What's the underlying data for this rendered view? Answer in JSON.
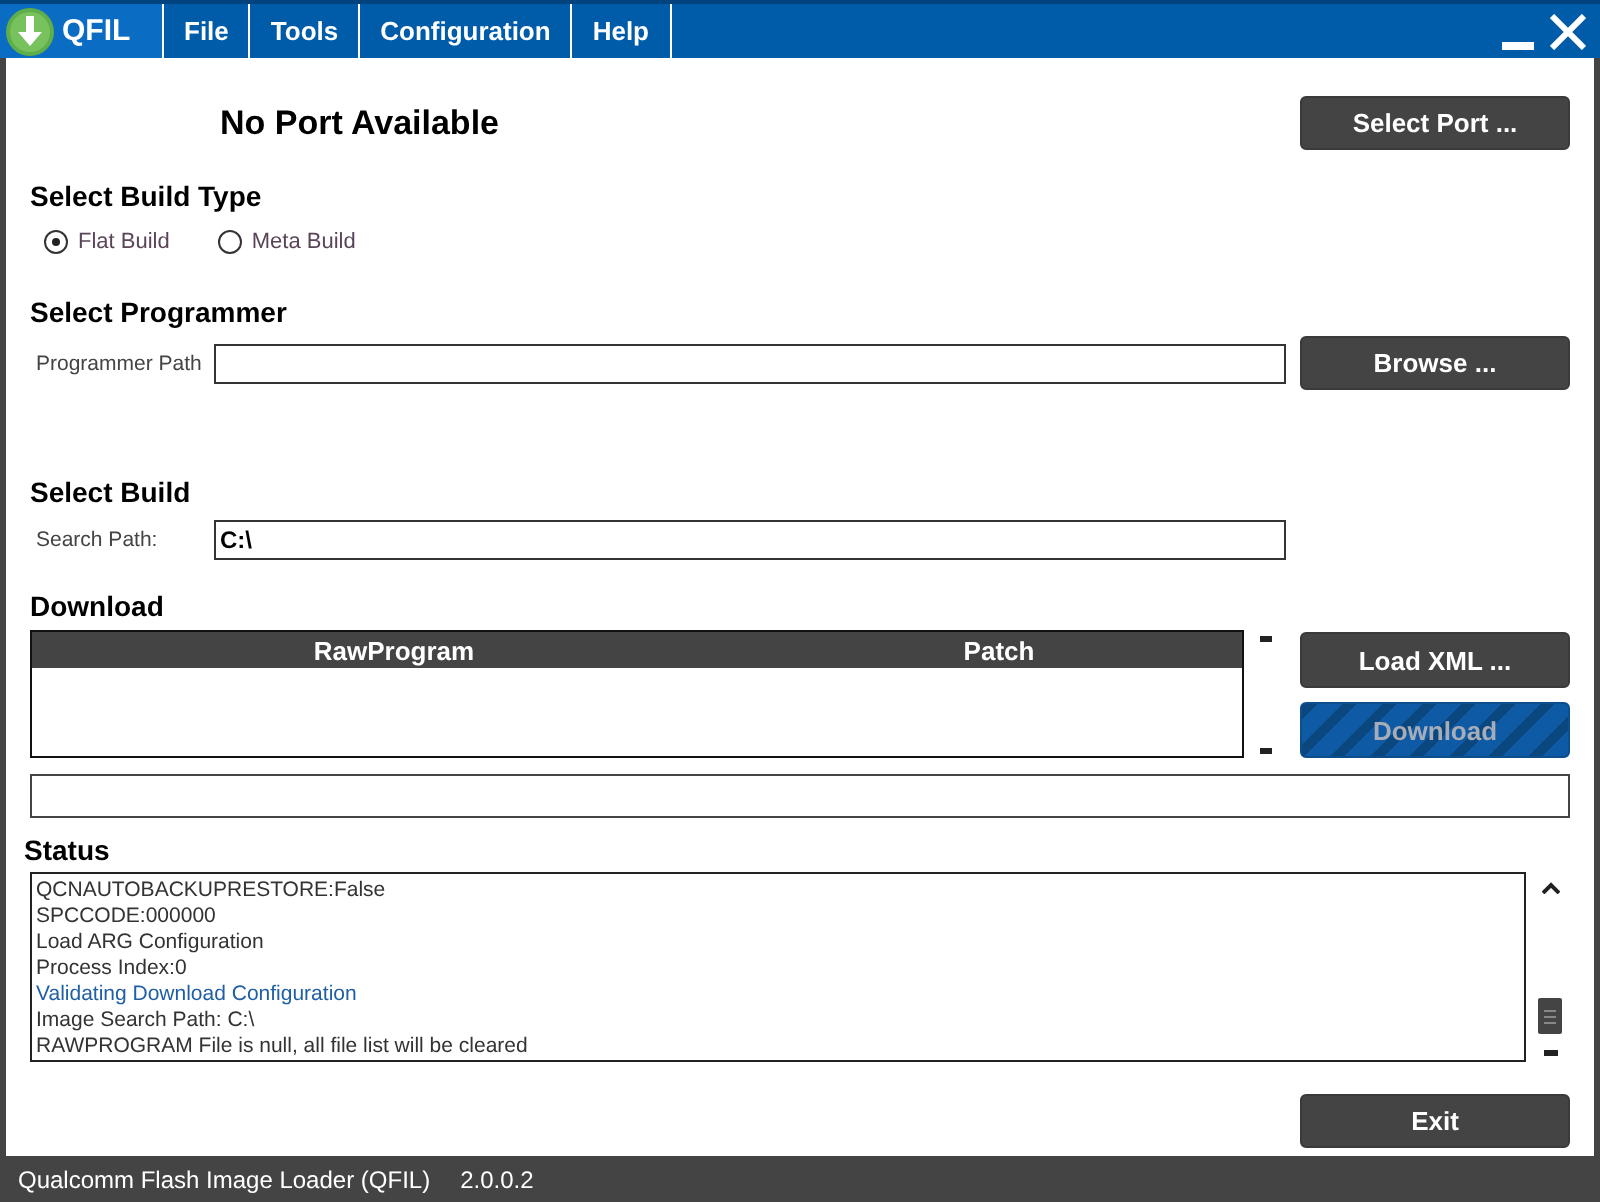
{
  "window": {
    "title": "QFIL"
  },
  "menu": [
    "File",
    "Tools",
    "Configuration",
    "Help"
  ],
  "port": {
    "status": "No Port Available",
    "button": "Select Port ..."
  },
  "build_type": {
    "heading": "Select Build Type",
    "options": [
      {
        "label": "Flat Build",
        "selected": true
      },
      {
        "label": "Meta Build",
        "selected": false
      }
    ]
  },
  "programmer": {
    "heading": "Select Programmer",
    "label": "Programmer Path",
    "button": "Browse ..."
  },
  "build": {
    "heading": "Select Build",
    "label": "Search Path:",
    "value": "C:\\"
  },
  "download": {
    "heading": "Download",
    "table": {
      "columns": [
        "RawProgram",
        "Patch"
      ]
    },
    "buttons": [
      {
        "label": "Load XML ...",
        "disabled": false
      },
      {
        "label": "Download",
        "disabled": true
      }
    ],
    "progress": {
      "level": 0
    }
  },
  "status": {
    "heading": "Status",
    "lines": [
      {
        "text": "QCNAUTOBACKUPRESTORE:False",
        "color": "#333333"
      },
      {
        "text": "SPCCODE:000000",
        "color": "#333333"
      },
      {
        "text": "Load ARG Configuration",
        "color": "#333333"
      },
      {
        "text": "Process Index:0",
        "color": "#333333"
      },
      {
        "text": "Validating Download Configuration",
        "color": "#1f5fa6"
      },
      {
        "text": "Image Search Path: C:\\",
        "color": "#333333"
      },
      {
        "text": "RAWPROGRAM File is null, all file list will be cleared",
        "color": "#333333"
      }
    ]
  },
  "exit_button": "Exit",
  "status_bar": {
    "app_name": "Qualcomm Flash Image Loader (QFIL)",
    "version": "2.0.0.2"
  }
}
